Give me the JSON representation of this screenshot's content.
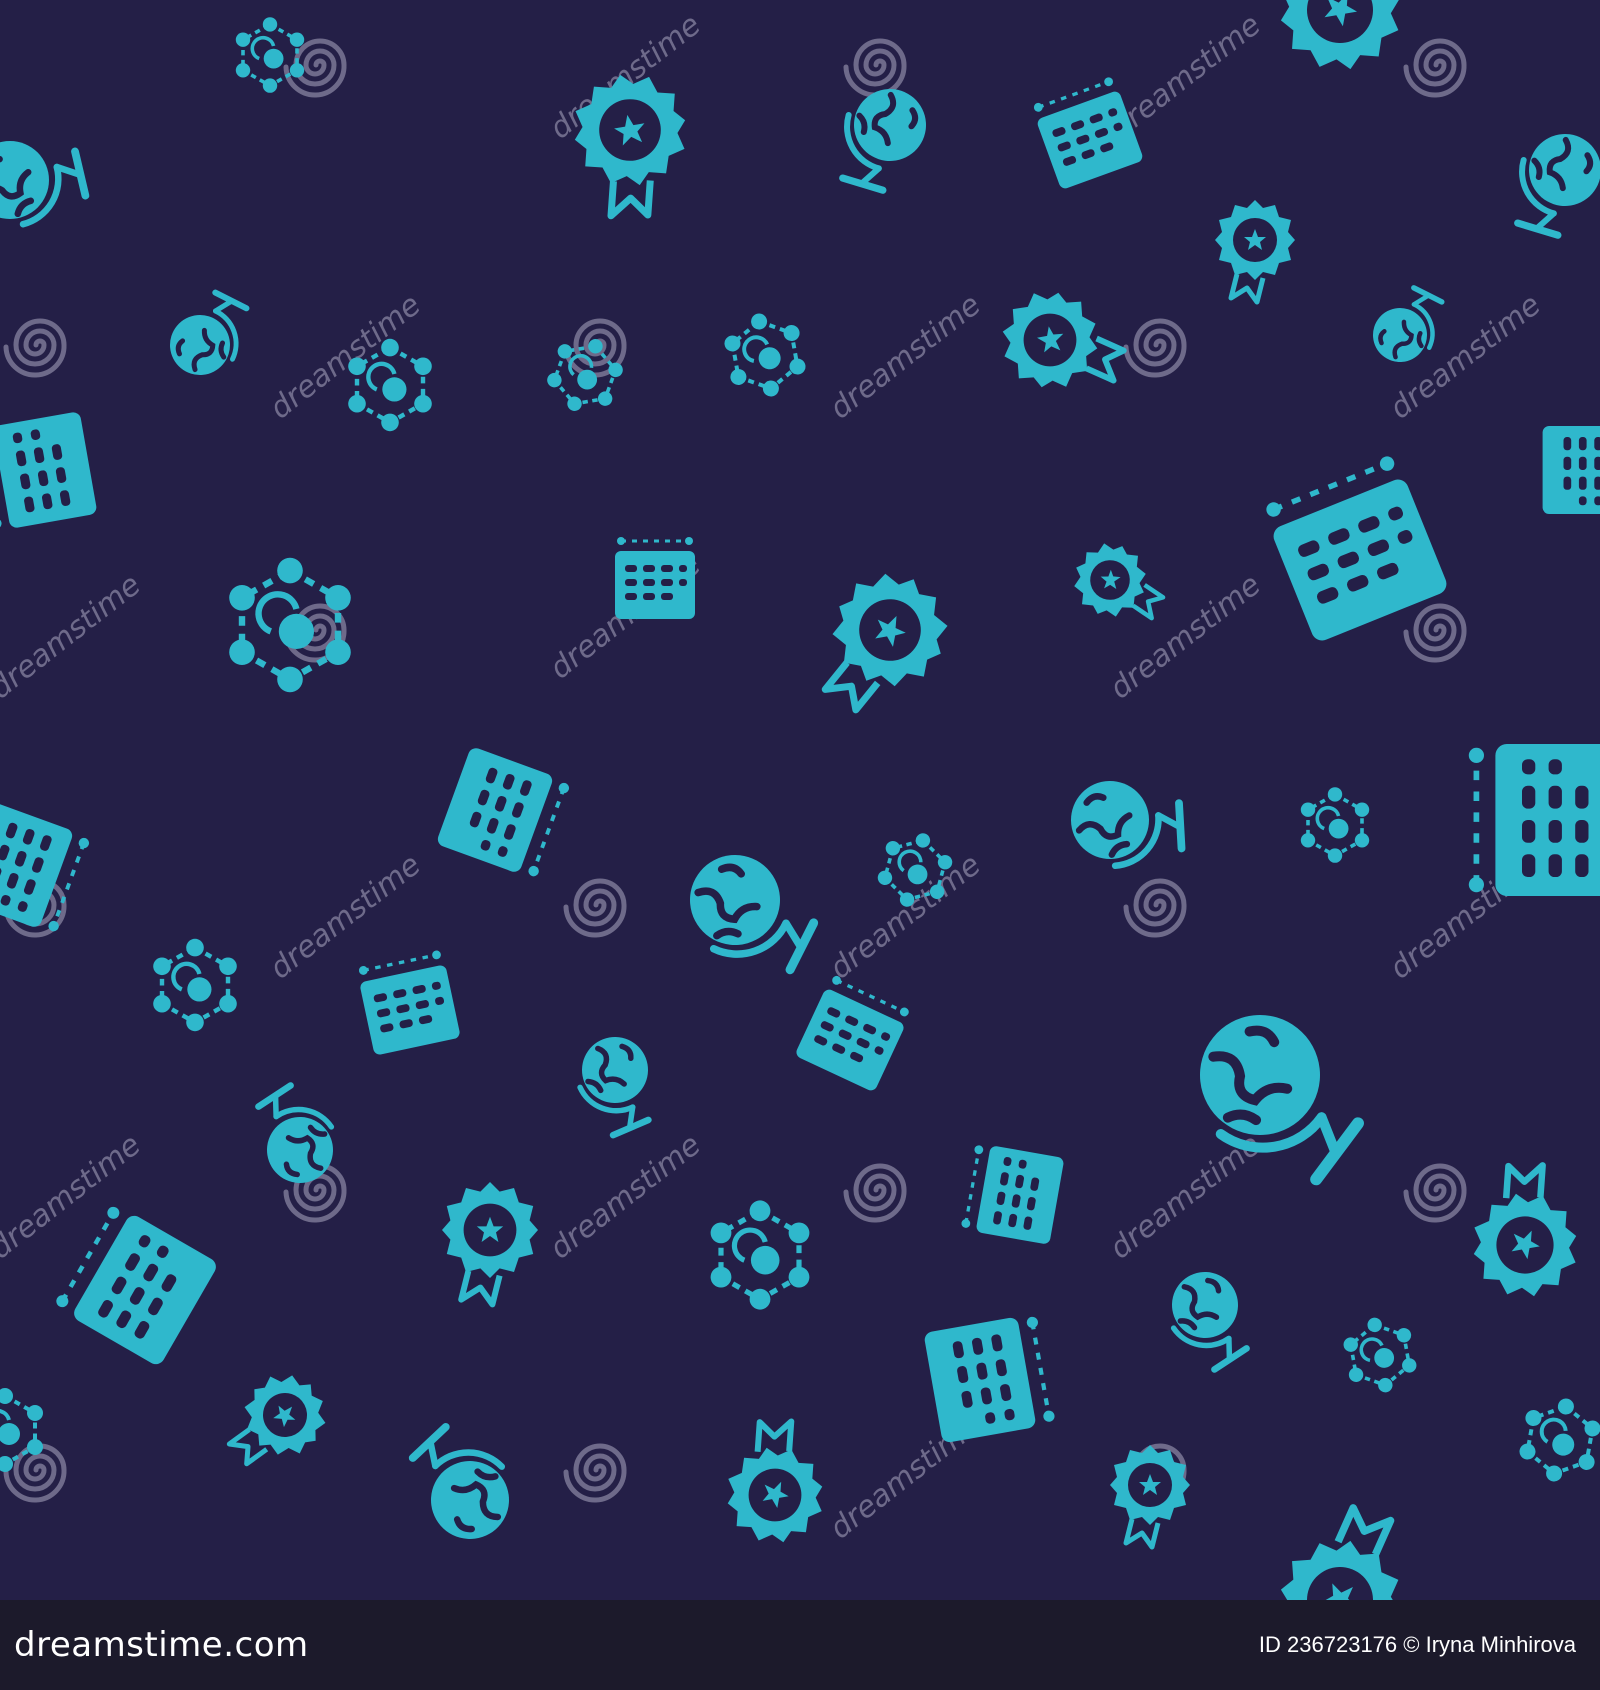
{
  "colors": {
    "background": "#241f47",
    "icon": "#2fb8cc",
    "watermark": "#6e6a8a",
    "footer_bg": "#1c1a2b"
  },
  "pattern": {
    "icon_types": [
      "globe-icon",
      "badge-icon",
      "calendar-icon",
      "network-icon"
    ],
    "watermark_text": "dreamstime",
    "watermark_icon": "swirl-logo-icon"
  },
  "footer": {
    "brand": "dreamstime.com",
    "image_id": "ID 236723176",
    "author": "© Iryna Minhirova"
  }
}
